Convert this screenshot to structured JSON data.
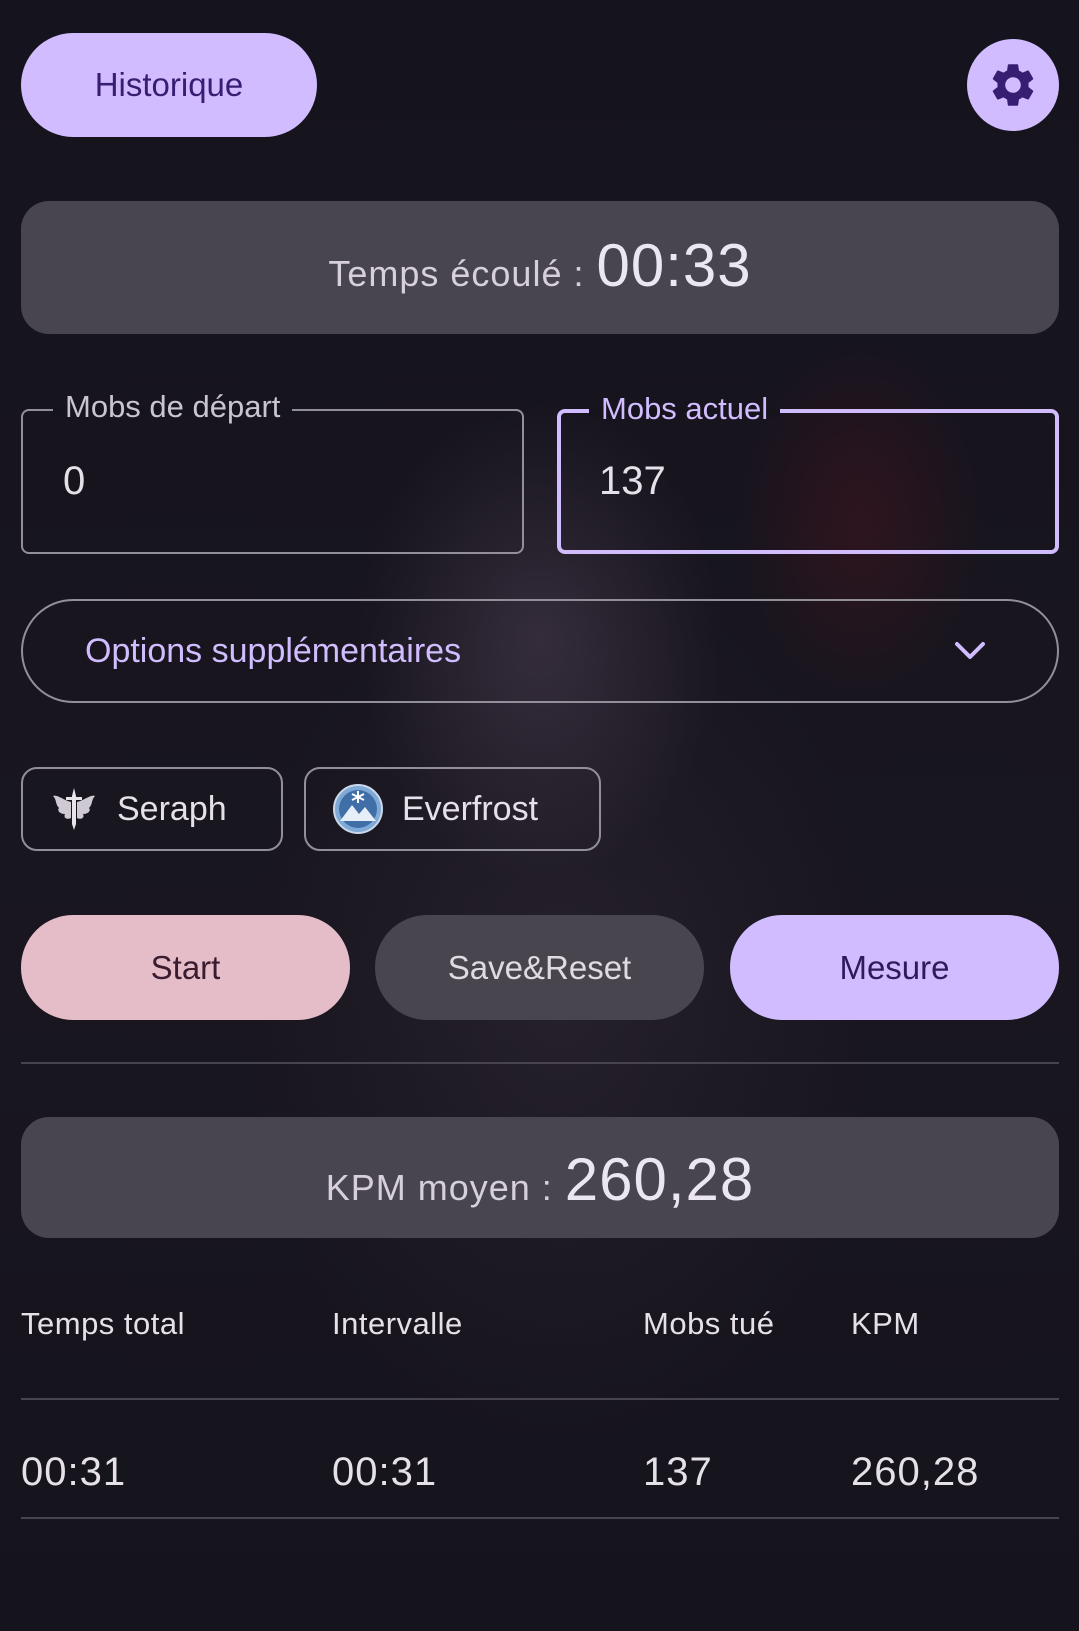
{
  "header": {
    "history_label": "Historique",
    "settings_icon": "gear-icon"
  },
  "timer": {
    "label": "Temps écoulé :",
    "value": "00:33"
  },
  "inputs": {
    "start_mobs": {
      "label": "Mobs de départ",
      "value": "0"
    },
    "current_mobs": {
      "label": "Mobs actuel",
      "value": "137"
    }
  },
  "options": {
    "label": "Options supplémentaires",
    "icon": "chevron-down-icon"
  },
  "chips": [
    {
      "label": "Seraph",
      "icon": "winged-sword-emblem-icon"
    },
    {
      "label": "Everfrost",
      "icon": "snow-mountain-emblem-icon"
    }
  ],
  "actions": {
    "start_label": "Start",
    "save_reset_label": "Save&Reset",
    "measure_label": "Mesure"
  },
  "average_kpm": {
    "label": "KPM moyen :",
    "value": "260,28"
  },
  "table": {
    "headers": [
      "Temps total",
      "Intervalle",
      "Mobs tué",
      "KPM"
    ],
    "rows": [
      [
        "00:31",
        "00:31",
        "137",
        "260,28"
      ]
    ]
  },
  "colors": {
    "primary": "#d0bcff",
    "on_primary": "#381e72",
    "tertiary_container": "#e5bdc9",
    "surface_variant": "#49454f",
    "outline": "#938f99",
    "background": "#13111b"
  }
}
